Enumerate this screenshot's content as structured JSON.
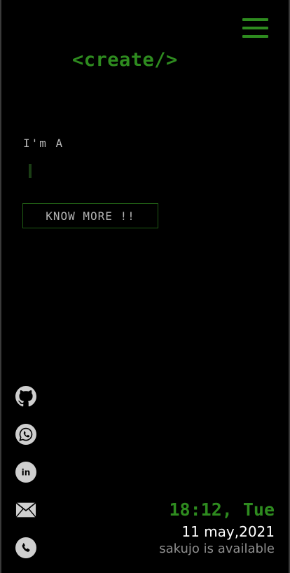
{
  "header": {
    "menu_icon": "hamburger-menu-icon",
    "logo_text": "<create/>",
    "accent_color": "#2e8b1f"
  },
  "hero": {
    "intro_text": "I'm A",
    "button_label": "KNOW MORE !!"
  },
  "social": {
    "items": [
      {
        "name": "github",
        "icon": "github-icon"
      },
      {
        "name": "whatsapp",
        "icon": "whatsapp-icon"
      },
      {
        "name": "linkedin",
        "icon": "linkedin-icon",
        "label": "in"
      },
      {
        "name": "email",
        "icon": "mail-icon"
      },
      {
        "name": "phone",
        "icon": "phone-icon"
      }
    ],
    "icon_color": "#cfcfcf"
  },
  "status": {
    "time": "18:12, Tue",
    "date": "11 may,2021",
    "availability": "sakujo is available"
  }
}
